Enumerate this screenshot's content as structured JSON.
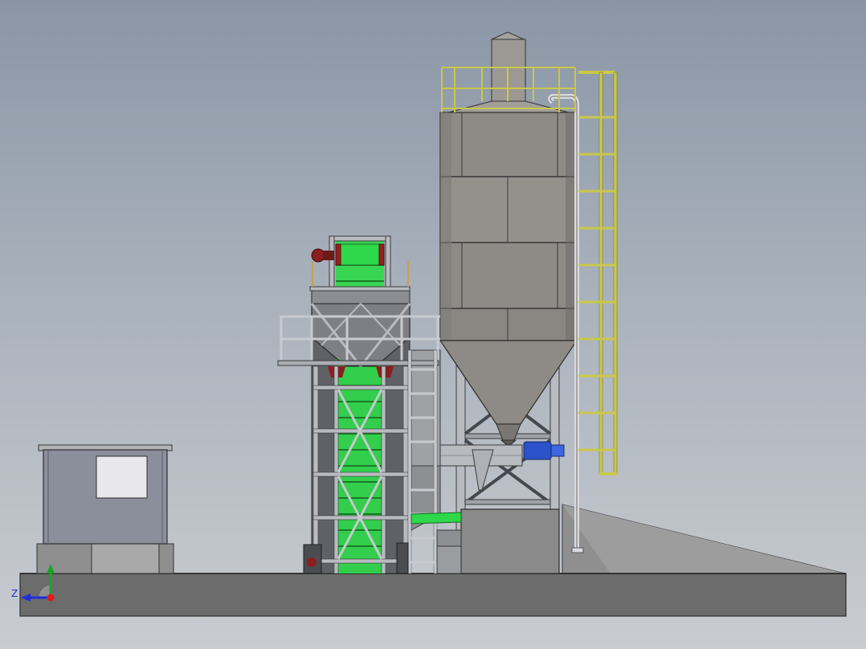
{
  "view": {
    "background_top": "#8a96a6",
    "background_bottom": "#c9ccd1"
  },
  "axis_triad": {
    "z_label": "Z",
    "colors": {
      "z": "#1f2fd8",
      "y": "#1aa52a",
      "x": "#e01a1a"
    }
  },
  "colors": {
    "concrete_top": "#9a9a9a",
    "concrete_front": "#6c6c6c",
    "ramp": "#8f8f8f",
    "silo_body": "#8e8b87",
    "railing": "#c9c84a",
    "belt": "#2fd84a",
    "steel": "#b8bcc2",
    "cabin": "#8b8f9b",
    "motor": "#2b52c8"
  },
  "components": [
    "control-cabin",
    "cement-silo",
    "belt-conveyor",
    "aggregate-hopper",
    "screw-conveyor",
    "silo-ladder",
    "foundation-slab"
  ]
}
